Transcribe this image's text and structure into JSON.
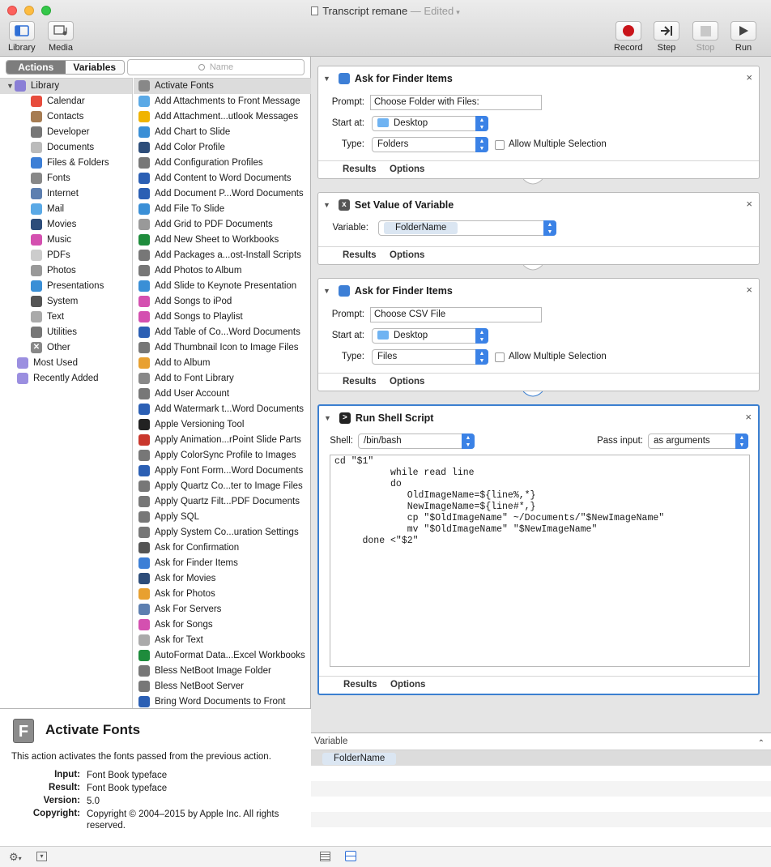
{
  "window": {
    "title": "Transcript remane",
    "edited": " — Edited",
    "traffic_colors": [
      "#fc615d",
      "#fdbc40",
      "#34c84a"
    ]
  },
  "toolbar": {
    "library": "Library",
    "media": "Media",
    "record": "Record",
    "step": "Step",
    "stop": "Stop",
    "run": "Run"
  },
  "sidebar": {
    "tab_actions": "Actions",
    "tab_variables": "Variables",
    "search_placeholder": "Name",
    "library_root": "Library",
    "categories": [
      {
        "label": "Calendar",
        "color": "#e74c3c"
      },
      {
        "label": "Contacts",
        "color": "#a67c52"
      },
      {
        "label": "Developer",
        "color": "#777777"
      },
      {
        "label": "Documents",
        "color": "#bbbbbb"
      },
      {
        "label": "Files & Folders",
        "color": "#3d7fd6"
      },
      {
        "label": "Fonts",
        "color": "#888888"
      },
      {
        "label": "Internet",
        "color": "#5d7fb0"
      },
      {
        "label": "Mail",
        "color": "#5aa9e6"
      },
      {
        "label": "Movies",
        "color": "#2d4d7a"
      },
      {
        "label": "Music",
        "color": "#d450b0"
      },
      {
        "label": "PDFs",
        "color": "#cccccc"
      },
      {
        "label": "Photos",
        "color": "#999999"
      },
      {
        "label": "Presentations",
        "color": "#3a8fd6"
      },
      {
        "label": "System",
        "color": "#555555"
      },
      {
        "label": "Text",
        "color": "#aaaaaa"
      },
      {
        "label": "Utilities",
        "color": "#777777"
      }
    ],
    "other": "Other",
    "most_used": "Most Used",
    "recently_added": "Recently Added"
  },
  "actions_list": [
    {
      "label": "Activate Fonts",
      "color": "#888888"
    },
    {
      "label": "Add Attachments to Front Message",
      "color": "#5aa9e6"
    },
    {
      "label": "Add Attachment...utlook Messages",
      "color": "#f0b400"
    },
    {
      "label": "Add Chart to Slide",
      "color": "#3a8fd6"
    },
    {
      "label": "Add Color Profile",
      "color": "#2d4d7a"
    },
    {
      "label": "Add Configuration Profiles",
      "color": "#777777"
    },
    {
      "label": "Add Content to Word Documents",
      "color": "#2b5fb4"
    },
    {
      "label": "Add Document P...Word Documents",
      "color": "#2b5fb4"
    },
    {
      "label": "Add File To Slide",
      "color": "#3a8fd6"
    },
    {
      "label": "Add Grid to PDF Documents",
      "color": "#999999"
    },
    {
      "label": "Add New Sheet to Workbooks",
      "color": "#1e8c3c"
    },
    {
      "label": "Add Packages a...ost-Install Scripts",
      "color": "#777777"
    },
    {
      "label": "Add Photos to Album",
      "color": "#777777"
    },
    {
      "label": "Add Slide to Keynote Presentation",
      "color": "#3a8fd6"
    },
    {
      "label": "Add Songs to iPod",
      "color": "#d450b0"
    },
    {
      "label": "Add Songs to Playlist",
      "color": "#d450b0"
    },
    {
      "label": "Add Table of Co...Word Documents",
      "color": "#2b5fb4"
    },
    {
      "label": "Add Thumbnail Icon to Image Files",
      "color": "#777777"
    },
    {
      "label": "Add to Album",
      "color": "#e8a030"
    },
    {
      "label": "Add to Font Library",
      "color": "#888888"
    },
    {
      "label": "Add User Account",
      "color": "#777777"
    },
    {
      "label": "Add Watermark t...Word Documents",
      "color": "#2b5fb4"
    },
    {
      "label": "Apple Versioning Tool",
      "color": "#222222"
    },
    {
      "label": "Apply Animation...rPoint Slide Parts",
      "color": "#c9372c"
    },
    {
      "label": "Apply ColorSync Profile to Images",
      "color": "#777777"
    },
    {
      "label": "Apply Font Form...Word Documents",
      "color": "#2b5fb4"
    },
    {
      "label": "Apply Quartz Co...ter to Image Files",
      "color": "#777777"
    },
    {
      "label": "Apply Quartz Filt...PDF Documents",
      "color": "#777777"
    },
    {
      "label": "Apply SQL",
      "color": "#777777"
    },
    {
      "label": "Apply System Co...uration Settings",
      "color": "#777777"
    },
    {
      "label": "Ask for Confirmation",
      "color": "#555555"
    },
    {
      "label": "Ask for Finder Items",
      "color": "#3d7fd6"
    },
    {
      "label": "Ask for Movies",
      "color": "#2d4d7a"
    },
    {
      "label": "Ask for Photos",
      "color": "#e8a030"
    },
    {
      "label": "Ask For Servers",
      "color": "#5d7fb0"
    },
    {
      "label": "Ask for Songs",
      "color": "#d450b0"
    },
    {
      "label": "Ask for Text",
      "color": "#aaaaaa"
    },
    {
      "label": "AutoFormat Data...Excel Workbooks",
      "color": "#1e8c3c"
    },
    {
      "label": "Bless NetBoot Image Folder",
      "color": "#777777"
    },
    {
      "label": "Bless NetBoot Server",
      "color": "#777777"
    },
    {
      "label": "Bring Word Documents to Front",
      "color": "#2b5fb4"
    }
  ],
  "description": {
    "icon_letter": "F",
    "title": "Activate Fonts",
    "text": "This action activates the fonts passed from the previous action.",
    "input_label": "Input:",
    "input_value": "Font Book typeface",
    "result_label": "Result:",
    "result_value": "Font Book typeface",
    "version_label": "Version:",
    "version_value": "5.0",
    "copyright_label": "Copyright:",
    "copyright_value": "Copyright © 2004–2015 by Apple Inc. All rights reserved."
  },
  "workflow": {
    "tab_results": "Results",
    "tab_options": "Options",
    "action1": {
      "title": "Ask for Finder Items",
      "prompt_label": "Prompt:",
      "prompt_value": "Choose Folder with Files:",
      "start_label": "Start at:",
      "start_value": "Desktop",
      "type_label": "Type:",
      "type_value": "Folders",
      "multi_label": "Allow Multiple Selection"
    },
    "action2": {
      "title": "Set Value of Variable",
      "variable_label": "Variable:",
      "variable_value": "FolderName"
    },
    "action3": {
      "title": "Ask for Finder Items",
      "prompt_label": "Prompt:",
      "prompt_value": "Choose CSV File",
      "start_label": "Start at:",
      "start_value": "Desktop",
      "type_label": "Type:",
      "type_value": "Files",
      "multi_label": "Allow Multiple Selection"
    },
    "action4": {
      "title": "Run Shell Script",
      "shell_label": "Shell:",
      "shell_value": "/bin/bash",
      "pass_label": "Pass input:",
      "pass_value": "as arguments",
      "script": "cd \"$1\"\n          while read line\n          do\n             OldImageName=${line%,*}\n             NewImageName=${line#*,}\n             cp \"$OldImageName\" ~/Documents/\"$NewImageName\"\n             mv \"$OldImageName\" \"$NewImageName\"\n     done <\"$2\""
    }
  },
  "variables_panel": {
    "header": "Variable",
    "rows": [
      "FolderName"
    ]
  }
}
